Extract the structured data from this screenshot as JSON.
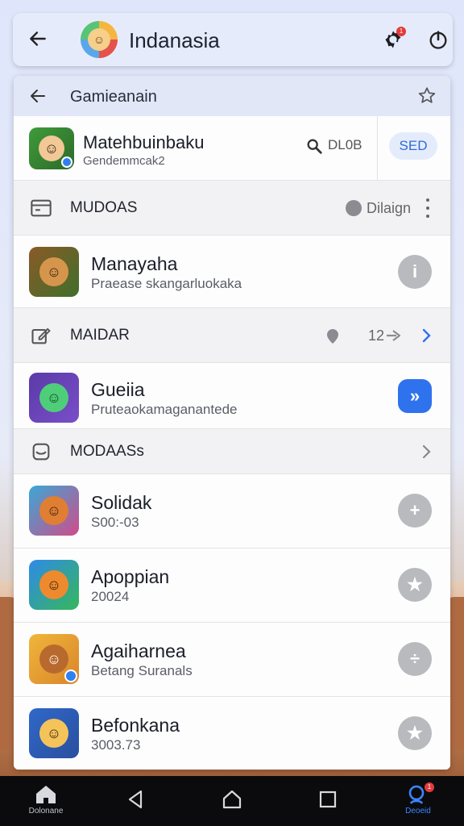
{
  "app_bar": {
    "title": "Indanasia",
    "notification_count": "1"
  },
  "panel": {
    "title": "Gamieanain",
    "featured": {
      "name": "Matehbuinbaku",
      "sub": "Gendemmcak2",
      "search_label": "DL0B",
      "button_label": "SED"
    },
    "sections": [
      {
        "label": "MUDOAS",
        "right_label": "Dilaign"
      },
      {
        "label": "MAIDAR",
        "count": "12"
      },
      {
        "label": "MODAASs"
      }
    ],
    "apps": [
      {
        "name": "Manayaha",
        "sub": "Praease skangarluokaka",
        "action": "i"
      },
      {
        "name": "Gueiia",
        "sub": "Pruteaokamaganantede",
        "action": "»"
      },
      {
        "name": "Solidak",
        "sub": "S00:-03",
        "action": "+"
      },
      {
        "name": "Apoppian",
        "sub": "20024",
        "action": "★"
      },
      {
        "name": "Agaiharnea",
        "sub": "Betang Suranals",
        "action": "÷"
      },
      {
        "name": "Befonkana",
        "sub": "3003.73",
        "action": "★"
      }
    ]
  },
  "nav": {
    "home_label": "Dolonane",
    "profile_label": "Deoeid",
    "profile_badge": "1"
  },
  "colors": {
    "accent_blue": "#2f72ee",
    "header_bg": "#e6ebfb",
    "badge_red": "#e23b3b"
  }
}
